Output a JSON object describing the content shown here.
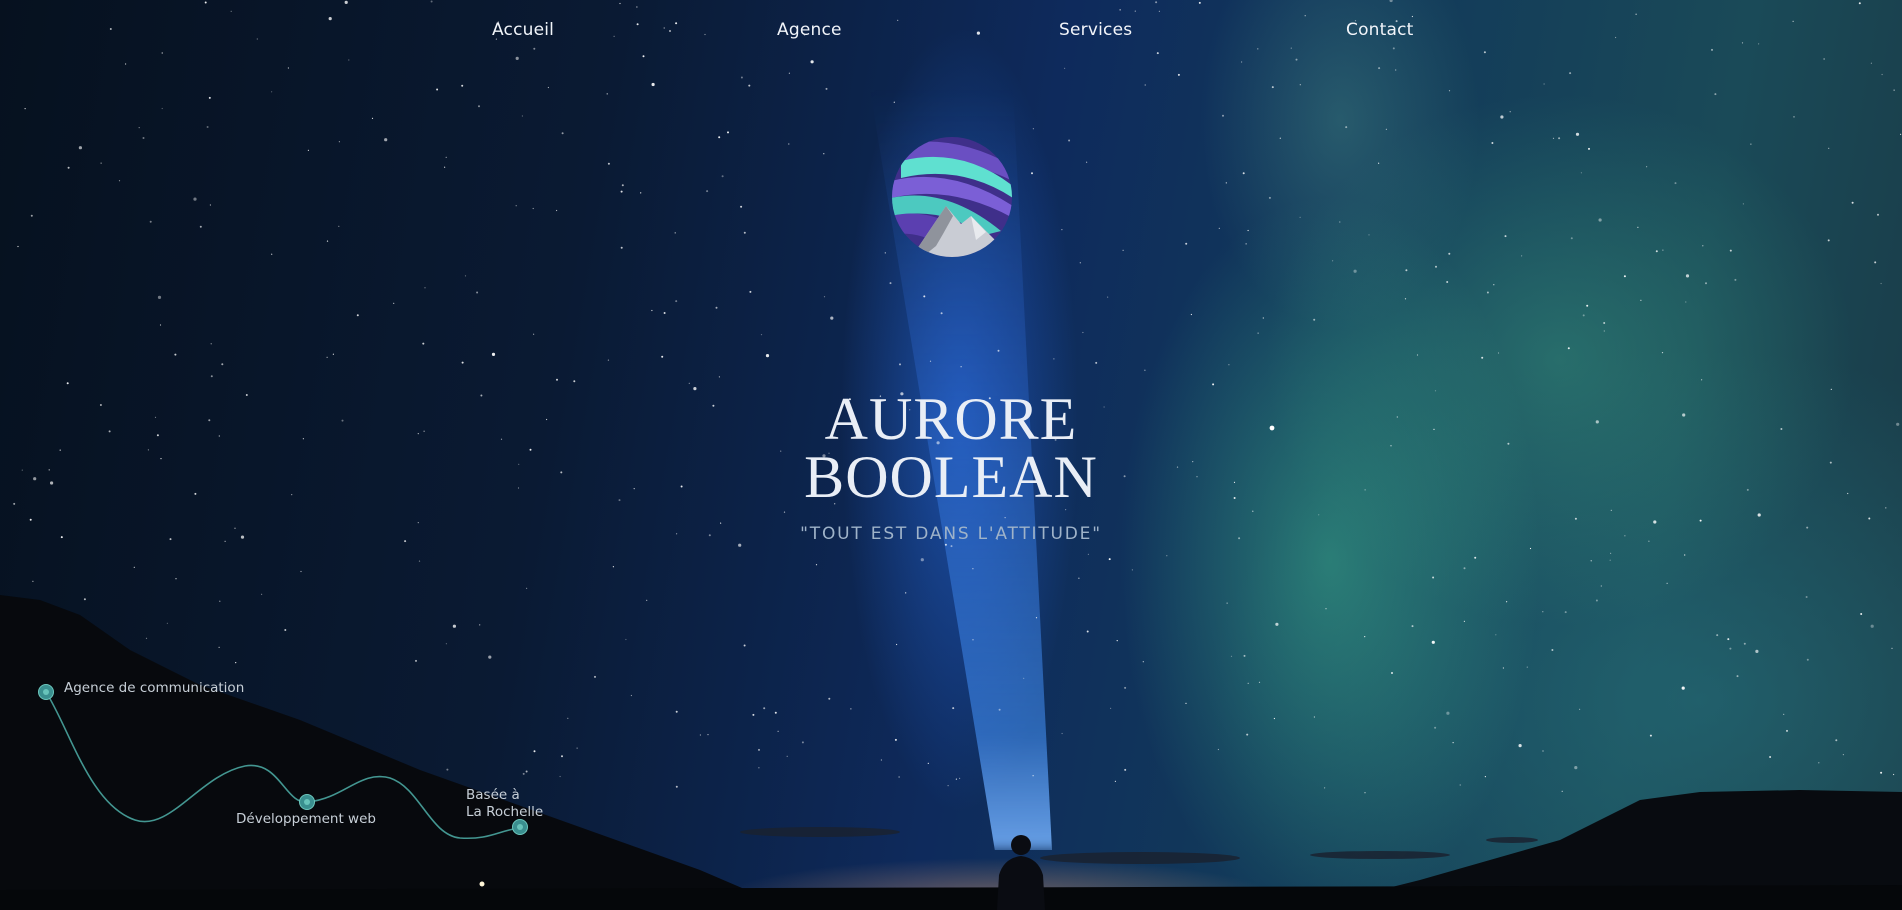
{
  "nav": {
    "items": [
      {
        "label": "Accueil"
      },
      {
        "label": "Agence"
      },
      {
        "label": "Services"
      },
      {
        "label": "Contact"
      }
    ]
  },
  "hero": {
    "title_line1": "AURORE",
    "title_line2": "BOOLEAN",
    "tagline": "\"TOUT EST DANS L'ATTITUDE\"",
    "logo_icon": "aurora-mountain-logo-icon",
    "background": "night-sky-aurora-photo"
  },
  "timeline": {
    "points": [
      {
        "label": "Agence de communication"
      },
      {
        "label": "Développement web"
      },
      {
        "label_line1": "Basée à",
        "label_line2": "La Rochelle"
      }
    ],
    "accent_color": "#4aa6a0"
  },
  "colors": {
    "text": "#f2f5fa",
    "tagline": "#9fb3c9",
    "aurora_green": "#3fb58c",
    "sky_blue": "#0e2a5c",
    "logo_purple": "#6a4fc2",
    "logo_teal": "#5fe0d0"
  }
}
